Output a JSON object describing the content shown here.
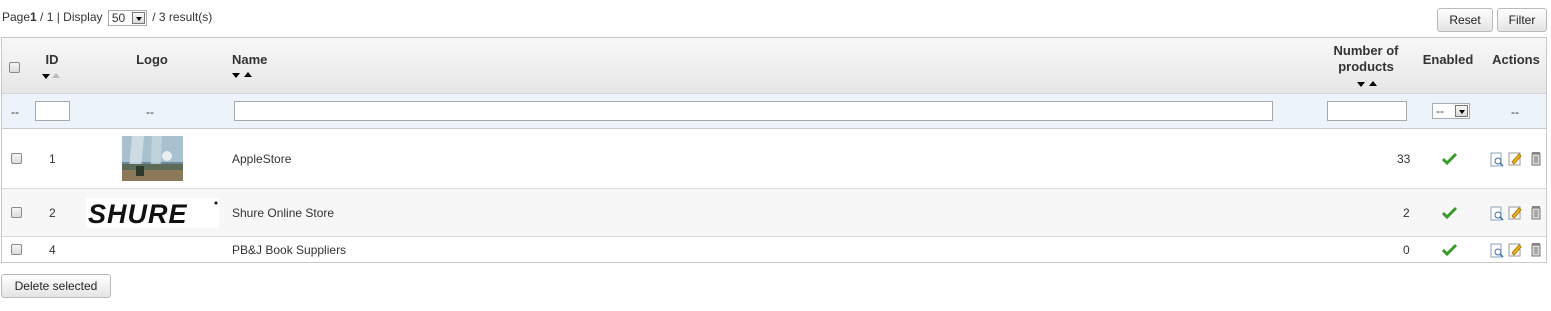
{
  "pager": {
    "page_label": "Page",
    "page_current": "1",
    "page_total_text": " / 1 | Display",
    "per_page": "50",
    "results_text": "/ 3 result(s)"
  },
  "toolbar": {
    "reset_label": "Reset",
    "filter_label": "Filter"
  },
  "columns": {
    "id": "ID",
    "logo": "Logo",
    "name": "Name",
    "products_line1": "Number of",
    "products_line2": "products",
    "enabled": "Enabled",
    "actions": "Actions"
  },
  "filters": {
    "select_all_dash": "--",
    "logo_dash": "--",
    "enabled_value": "--",
    "actions_dash": "--",
    "id_value": "",
    "name_value": "",
    "products_value": ""
  },
  "rows": [
    {
      "id": "1",
      "logo": "storefront-photo",
      "name": "AppleStore",
      "products": "33",
      "enabled": true
    },
    {
      "id": "2",
      "logo": "shure-logo",
      "logo_text": "SHURE",
      "name": "Shure Online Store",
      "products": "2",
      "enabled": true
    },
    {
      "id": "4",
      "logo": "",
      "name": "PB&J Book Suppliers",
      "products": "0",
      "enabled": true
    }
  ],
  "bulk": {
    "delete_label": "Delete selected"
  },
  "colors": {
    "accent_check": "#3a9a2b",
    "filter_row_bg": "#ecf3fb",
    "header_bg": "#eeeeee"
  }
}
